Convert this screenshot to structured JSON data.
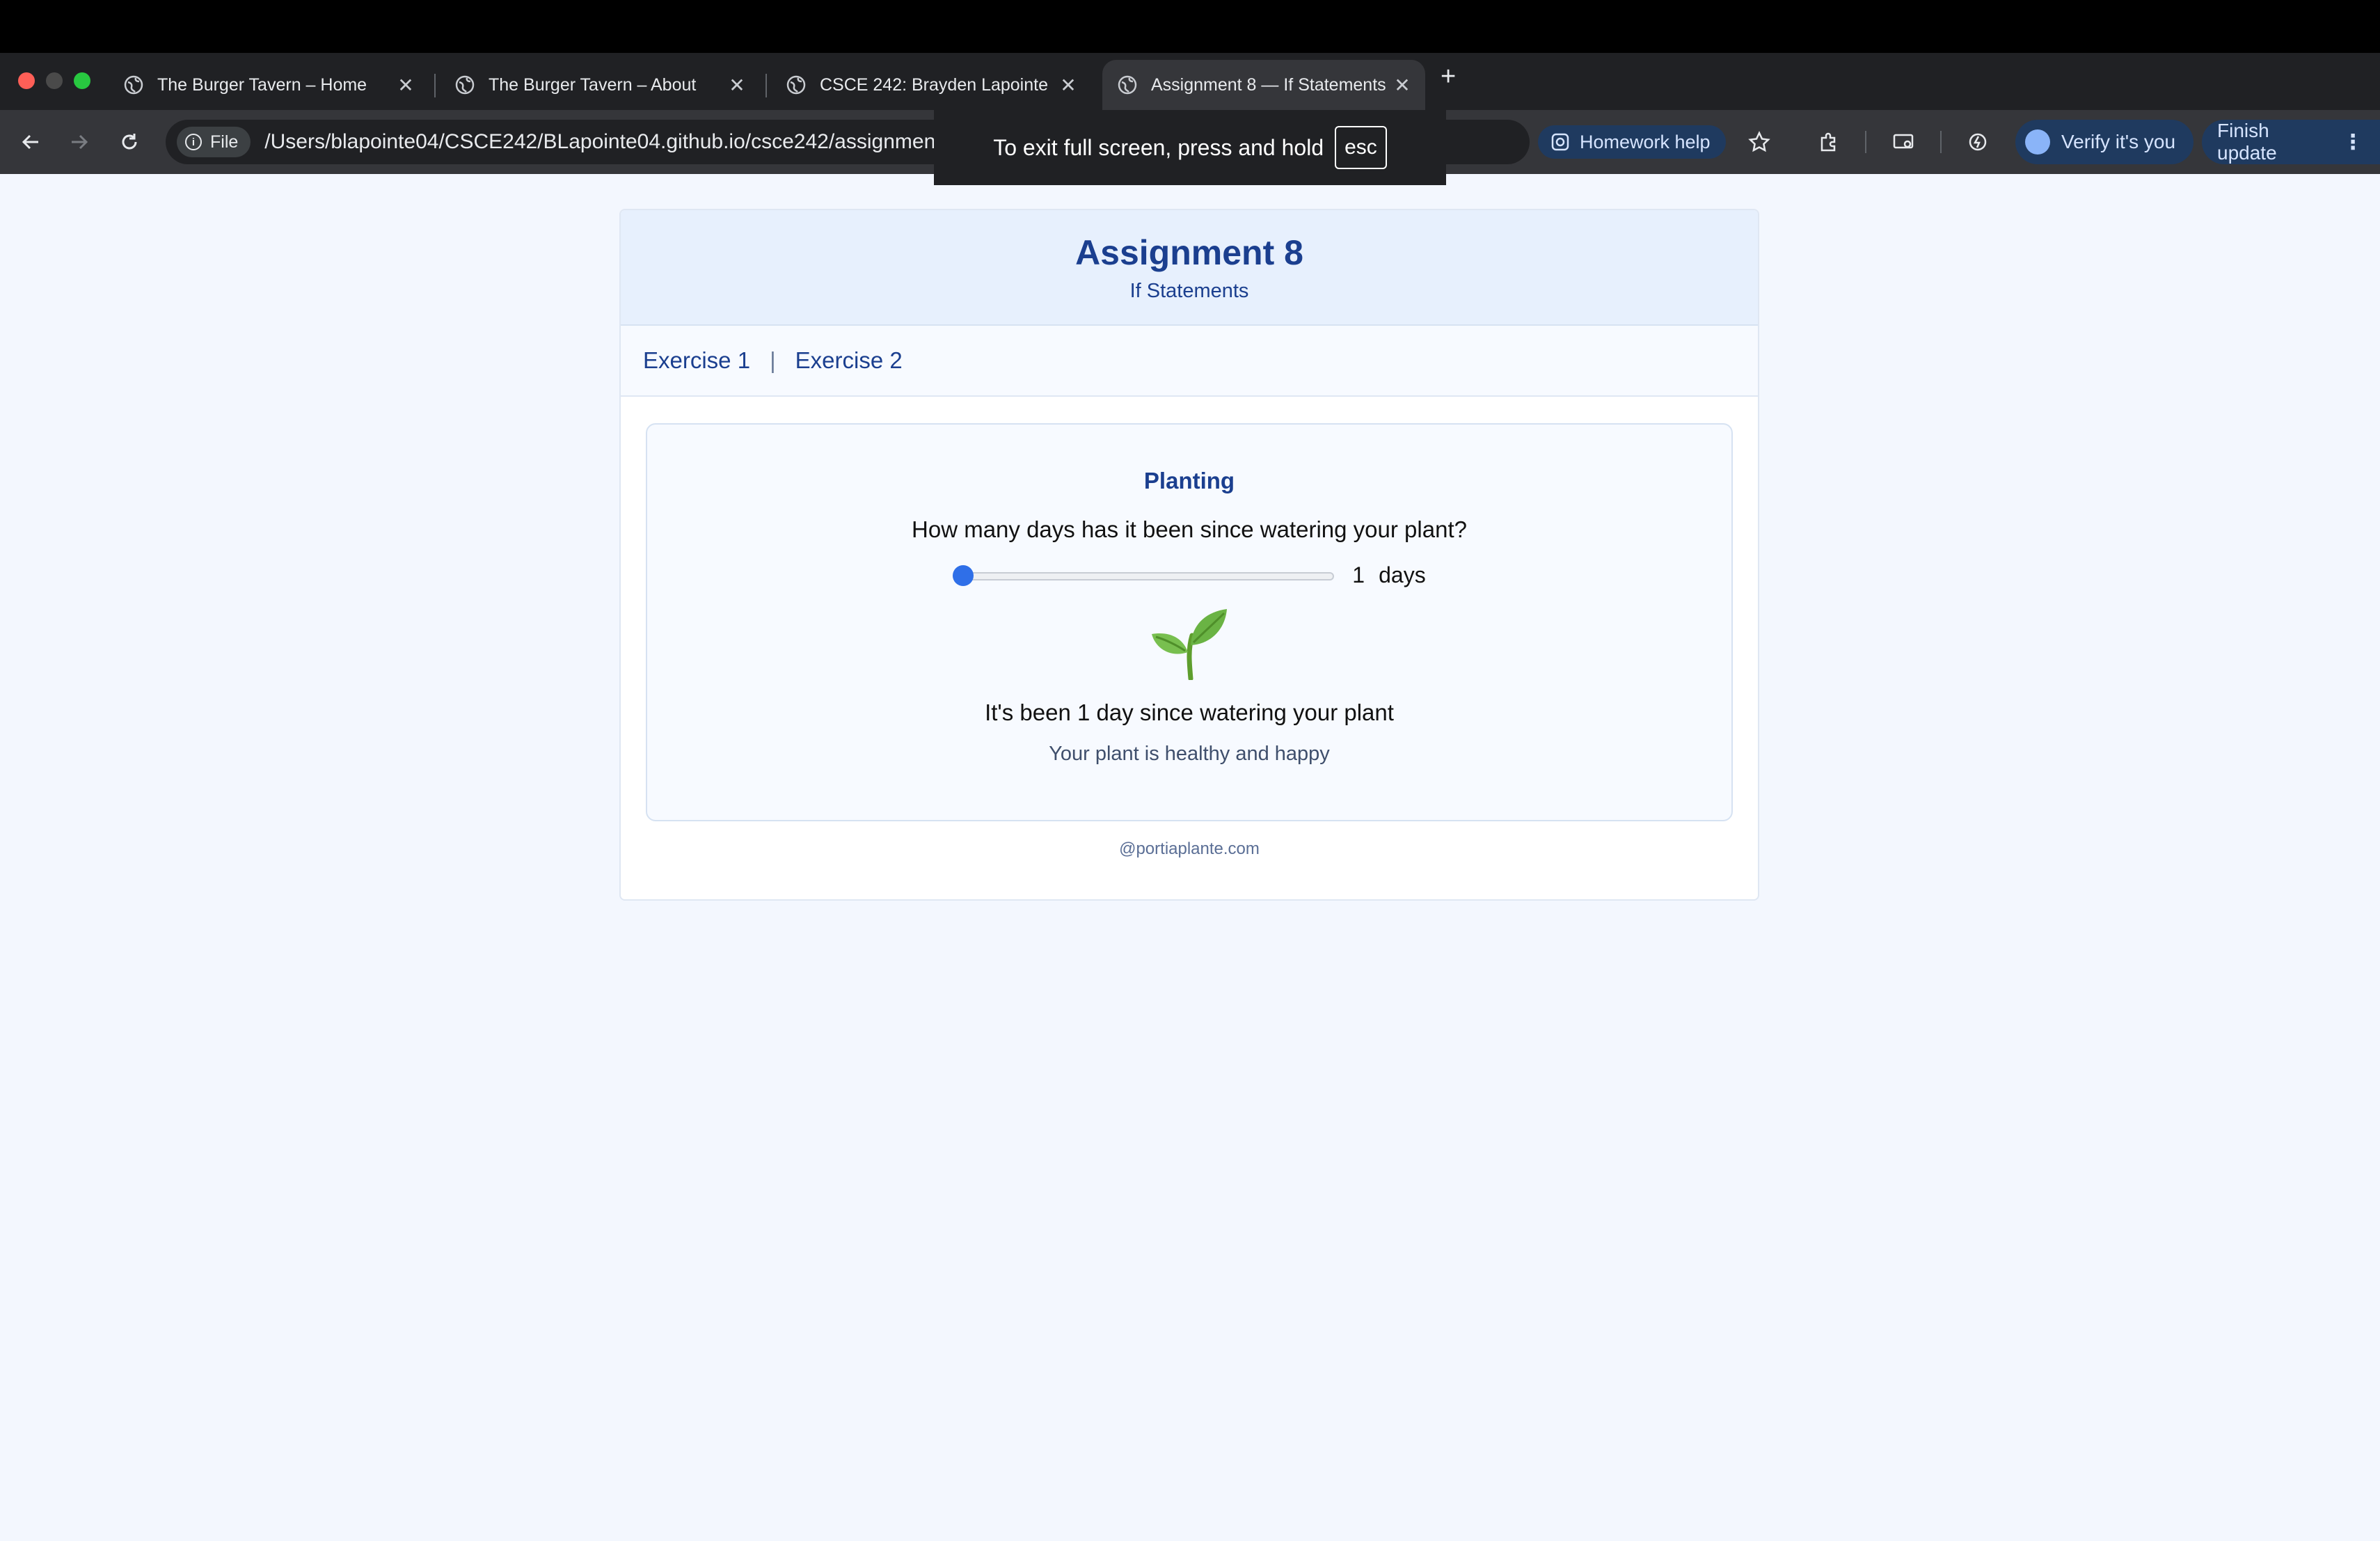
{
  "browser": {
    "tabs": [
      {
        "title": "The Burger Tavern – Home",
        "active": false
      },
      {
        "title": "The Burger Tavern – About",
        "active": false
      },
      {
        "title": "CSCE 242: Brayden Lapointe",
        "active": false
      },
      {
        "title": "Assignment 8 — If Statements",
        "active": true
      }
    ],
    "new_tab_label": "+",
    "address": {
      "scheme_chip": "File",
      "url": "/Users/blapointe04/CSCE242/BLapointe04.github.io/csce242/assignment"
    },
    "homework_help_label": "Homework help",
    "verify_label": "Verify it's you",
    "finish_update_label": "Finish update"
  },
  "fullscreen_toast": {
    "message": "To exit full screen, press and hold",
    "key": "esc"
  },
  "page": {
    "title": "Assignment 8",
    "subtitle": "If Statements",
    "nav": {
      "exercise1": "Exercise 1",
      "separator": "|",
      "exercise2": "Exercise 2"
    },
    "planting": {
      "heading": "Planting",
      "question": "How many days has it been since watering your plant?",
      "slider_value": "1",
      "slider_fraction": 0,
      "slider_unit": "days",
      "status": "It's been 1 day since watering your plant",
      "health": "Your plant is healthy and happy"
    },
    "footer": "@portiaplante.com"
  },
  "colors": {
    "accent": "#1b3f8f",
    "slider_thumb": "#2f6fe8",
    "page_bg": "#f3f7fe"
  }
}
